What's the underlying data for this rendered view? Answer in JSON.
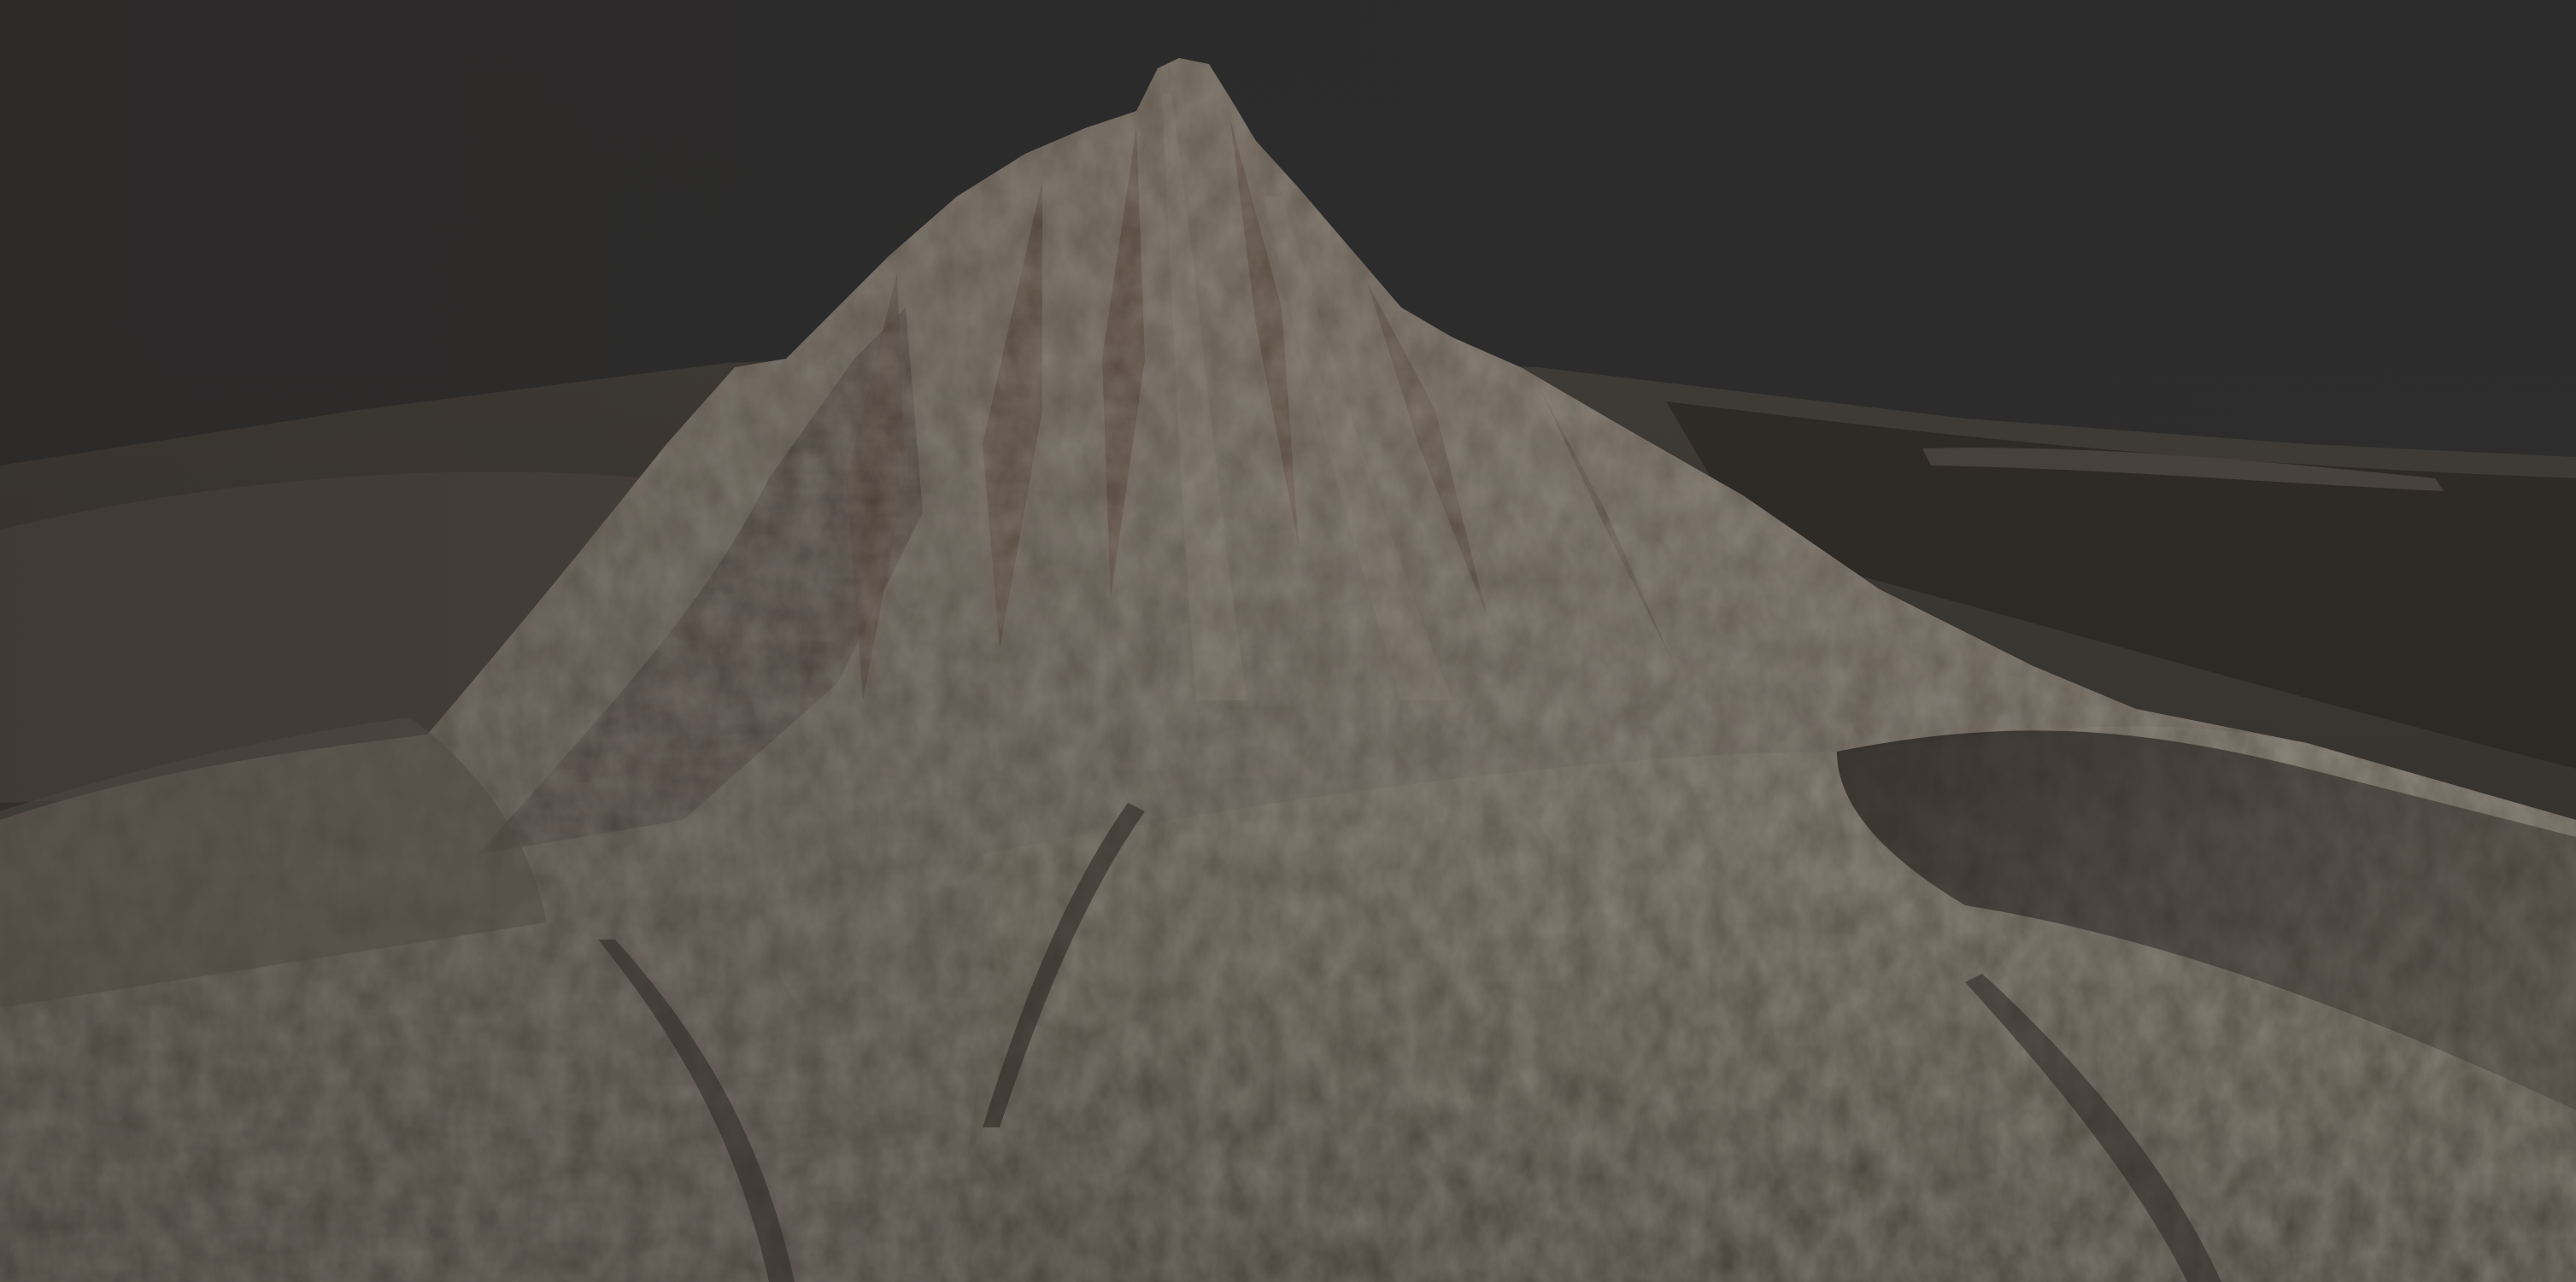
{
  "scene": {
    "subject_icon": "mountain-terrain-render",
    "colors": {
      "background": "#2c2c2d",
      "horizon_plain": "#3a3733",
      "rock_light": "#8a8173",
      "rock_mid": "#5f5850",
      "rock_dark": "#3a322c",
      "rock_rust": "#5a3f2e",
      "shadow": "#221f1c"
    }
  }
}
